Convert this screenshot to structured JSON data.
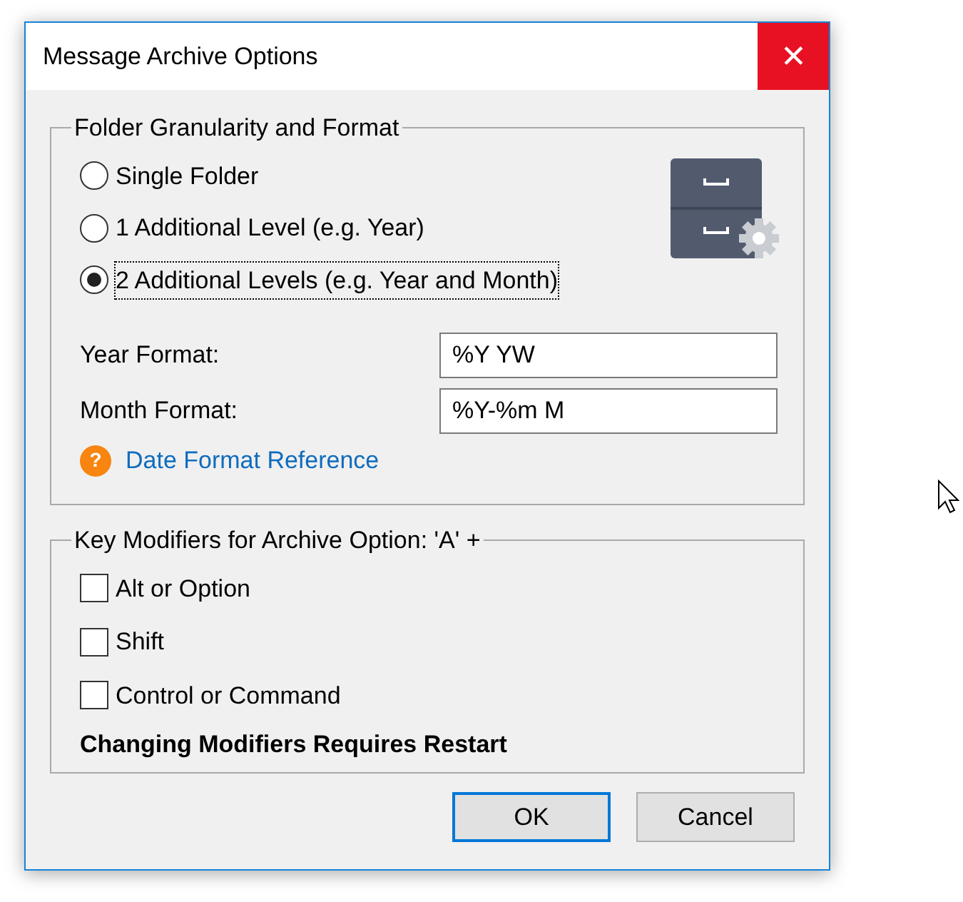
{
  "window": {
    "title": "Message Archive Options",
    "close": "✕"
  },
  "folder_group": {
    "title": "Folder Granularity and Format",
    "options": [
      {
        "label": "Single Folder",
        "selected": false
      },
      {
        "label": "1 Additional Level (e.g. Year)",
        "selected": false
      },
      {
        "label": "2 Additional Levels (e.g. Year and Month)",
        "selected": true
      }
    ],
    "fields": [
      {
        "label": "Year Format:",
        "value": "%Y YW"
      },
      {
        "label": "Month Format:",
        "value": "%Y-%m M"
      }
    ],
    "help_icon": "?",
    "link": "Date Format Reference"
  },
  "modifiers_group": {
    "title": "Key Modifiers for Archive Option: 'A' +",
    "checkboxes": [
      {
        "label": "Alt or Option",
        "checked": false
      },
      {
        "label": "Shift",
        "checked": false
      },
      {
        "label": "Control or Command",
        "checked": false
      }
    ],
    "note": "Changing Modifiers Requires Restart"
  },
  "buttons": [
    {
      "label": "OK",
      "default": true
    },
    {
      "label": "Cancel",
      "default": false
    }
  ]
}
